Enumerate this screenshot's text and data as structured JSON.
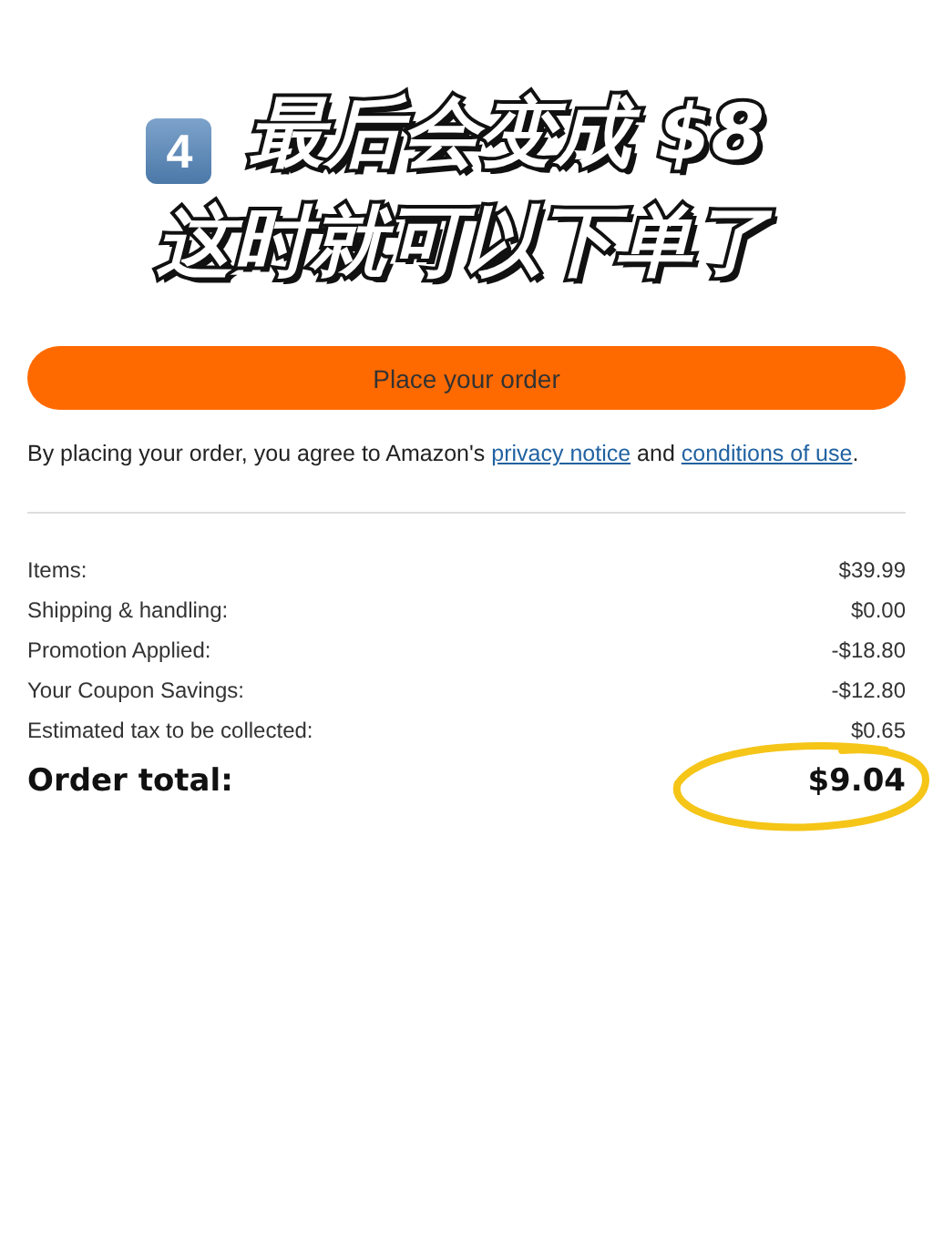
{
  "caption": {
    "badge": "4",
    "lines": [
      "最后会变成 $8",
      "这时就可以下单了"
    ]
  },
  "place_order_button": "Place your order",
  "agreement": {
    "before": "By placing your order, you agree to Amazon's",
    "link_1": "privacy notice",
    "middle": "and",
    "link_2": "conditions of use",
    "after": "."
  },
  "summary": [
    {
      "label": "Items:",
      "value": "$39.99"
    },
    {
      "label": "Shipping & handling:",
      "value": "$0.00"
    },
    {
      "label": "Promotion Applied:",
      "value": "-$18.80"
    },
    {
      "label": "Your Coupon Savings:",
      "value": "-$12.80"
    },
    {
      "label": "Estimated tax to be collected:",
      "value": "$0.65"
    }
  ],
  "total": {
    "label": "Order total:",
    "value": "$9.04",
    "circled": true
  }
}
